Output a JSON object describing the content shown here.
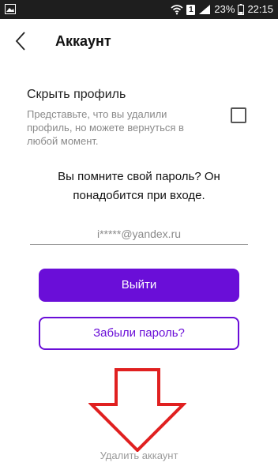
{
  "status_bar": {
    "battery": "23%",
    "time": "22:15",
    "sim_badge": "1",
    "icons": [
      "gallery-icon",
      "wifi-icon",
      "sim-icon",
      "signal-icon",
      "battery-icon"
    ]
  },
  "header": {
    "title": "Аккаунт",
    "back_icon": "back-chevron-icon"
  },
  "hide_profile": {
    "title": "Скрыть профиль",
    "description": "Представьте, что вы удалили профиль, но можете вернуться в любой момент.",
    "checked": false
  },
  "password_reminder": {
    "text": "Вы помните свой пароль? Он понадобится при входе."
  },
  "email_field": {
    "value": "i*****@yandex.ru"
  },
  "buttons": {
    "logout_label": "Выйти",
    "forgot_label": "Забыли пароль?"
  },
  "delete_account": {
    "label": "Удалить аккаунт"
  },
  "colors": {
    "accent": "#6a0ed8",
    "annotation": "#e02020",
    "status_bar": "#1e1e1e"
  }
}
